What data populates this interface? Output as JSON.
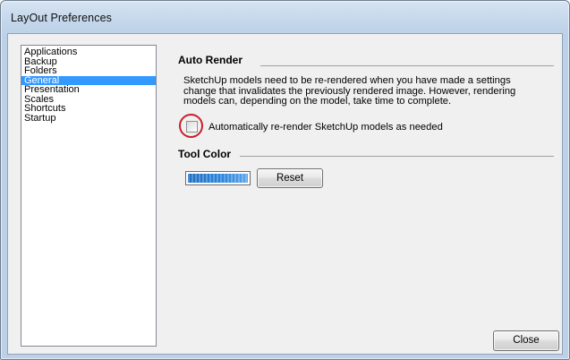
{
  "window": {
    "title": "LayOut Preferences"
  },
  "sidebar": {
    "items": [
      {
        "label": "Applications",
        "selected": false
      },
      {
        "label": "Backup",
        "selected": false
      },
      {
        "label": "Folders",
        "selected": false
      },
      {
        "label": "General",
        "selected": true
      },
      {
        "label": "Presentation",
        "selected": false
      },
      {
        "label": "Scales",
        "selected": false
      },
      {
        "label": "Shortcuts",
        "selected": false
      },
      {
        "label": "Startup",
        "selected": false
      }
    ]
  },
  "auto_render": {
    "header": "Auto Render",
    "description_lines": [
      "SketchUp models need to be re-rendered when you have made a settings",
      "change that invalidates the previously rendered image.  However, rendering",
      "models can, depending on the model, take time to complete."
    ],
    "checkbox_label": "Automatically re-render SketchUp models as needed",
    "checkbox_checked": false
  },
  "tool_color": {
    "header": "Tool Color",
    "swatch_color": "#2a7fd6",
    "reset_label": "Reset"
  },
  "footer": {
    "close_label": "Close"
  },
  "colors": {
    "selection": "#3399ff",
    "highlight_ring": "#c8202a"
  }
}
